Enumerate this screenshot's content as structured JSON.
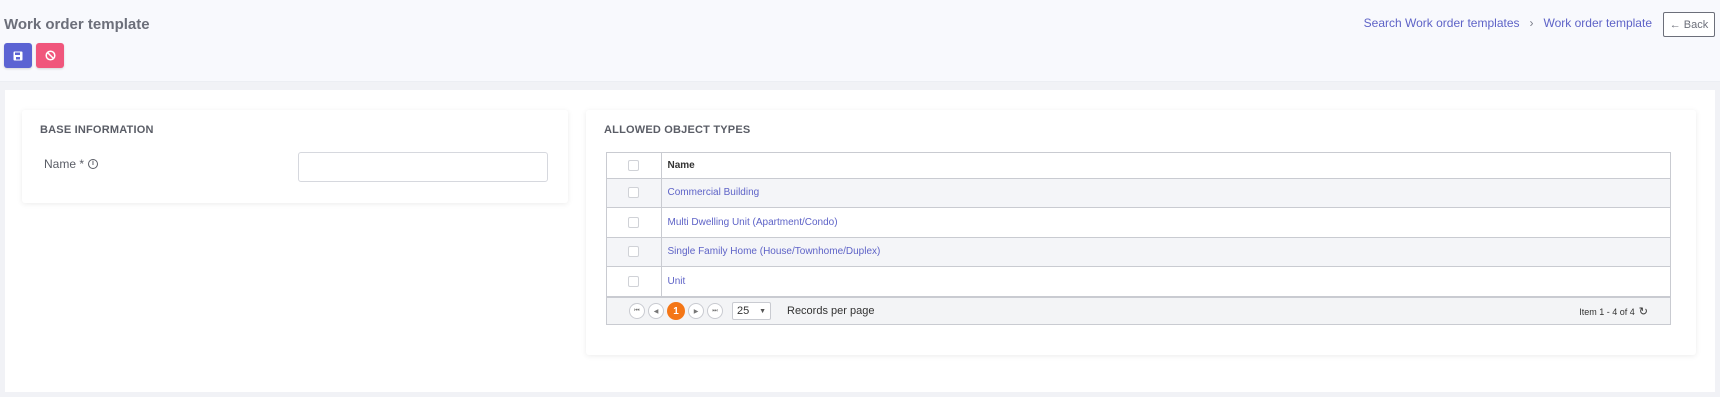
{
  "header": {
    "title": "Work order template",
    "save_icon": "save-icon",
    "cancel_icon": "cancel-icon",
    "breadcrumb": {
      "items": [
        "Search Work order templates",
        "Work order template"
      ],
      "separator": "›"
    },
    "back_label": "Back",
    "back_icon": "←"
  },
  "base_information": {
    "title": "BASE INFORMATION",
    "name_label": "Name *",
    "name_info_icon": "i",
    "name_value": ""
  },
  "allowed_object_types": {
    "title": "ALLOWED OBJECT TYPES",
    "columns": [
      "Name"
    ],
    "rows": [
      "Commercial Building",
      "Multi Dwelling Unit (Apartment/Condo)",
      "Single Family Home (House/Townhome/Duplex)",
      "Unit"
    ],
    "pager": {
      "current_page": "1",
      "page_size": "25",
      "records_label": "Records per page",
      "item_info": "Item 1 - 4 of 4",
      "refresh_icon": "↻"
    }
  },
  "colors": {
    "primary": "#5b63d3",
    "danger": "#f0567c",
    "link": "#5e63c7",
    "page_active": "#f47616"
  }
}
